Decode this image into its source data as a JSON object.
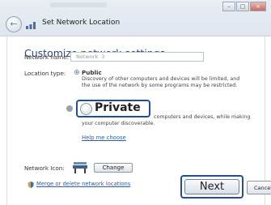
{
  "window": {
    "title": "Set Network Location",
    "controls": [
      "minimize",
      "maximize",
      "close"
    ]
  },
  "page": {
    "heading": "Customize network settings",
    "network_name_label": "Network name:",
    "network_name_value": "Network  3",
    "location_type_label": "Location type:",
    "public": {
      "label": "Public",
      "selected": true,
      "description_line1": "Discovery of other computers and devices will be limited, and",
      "description_line2": "the use of the network by some programs may be restricted."
    },
    "private": {
      "label": "Private",
      "selected": false,
      "description_line1": "computers and devices, while making",
      "description_line2": "your computer discoverable."
    },
    "help_link": "Help me choose",
    "network_icon_label": "Network Icon:",
    "change_button": "Change",
    "merge_link": "Merge or delete network locations"
  },
  "footer": {
    "next_button": "Next",
    "cancel_button": "Cancel"
  },
  "colors": {
    "callout_border": "#1f4e9c",
    "heading": "#2b4a7a",
    "link": "#2d5ea6"
  }
}
